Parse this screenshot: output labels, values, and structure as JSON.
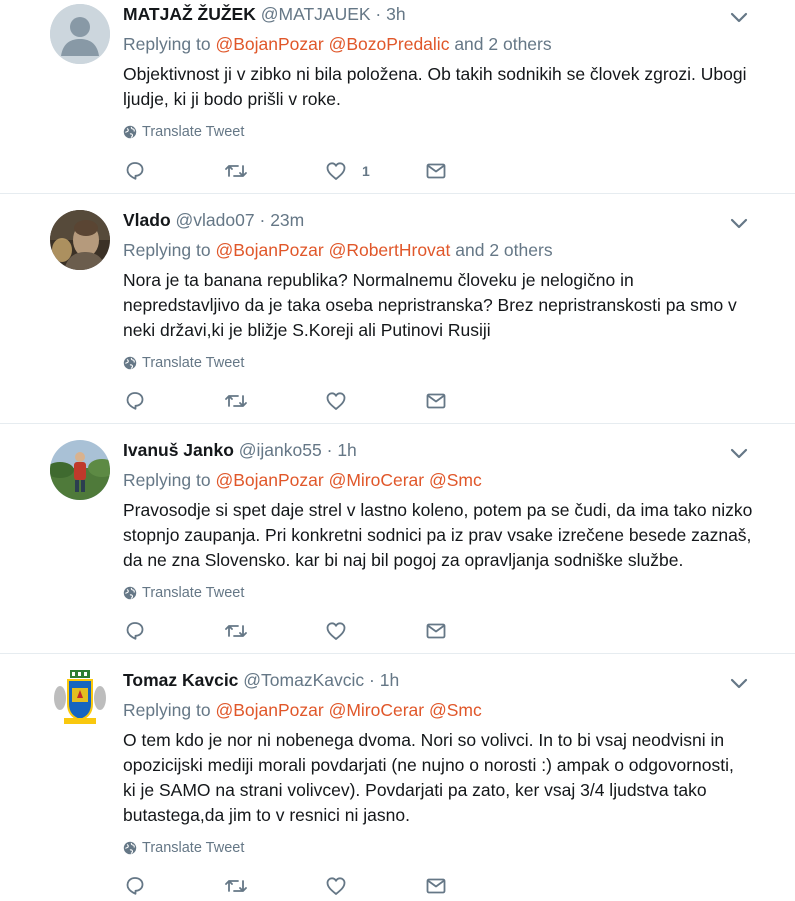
{
  "icons": {
    "caret": "chevron-down-icon",
    "globe": "globe-icon",
    "reply": "reply-icon",
    "retweet": "retweet-icon",
    "like": "heart-icon",
    "message": "envelope-icon"
  },
  "colors": {
    "mention": "#e0572a",
    "muted": "#657786",
    "text": "#14171a",
    "border": "#e6ecf0"
  },
  "tweets": [
    {
      "name": "MATJAŽ ŽUŽEK",
      "handle": "@MATJAUEK",
      "dot": "·",
      "time": "3h",
      "replying_prefix": "Replying to",
      "mentions": [
        "@BojanPozar",
        "@BozoPredalic"
      ],
      "replying_suffix": "and 2 others",
      "lines": [
        "Objektivnost ji v zibko ni bila položena. Ob takih sodnikih se človek zgrozi. Ubogi",
        "ljudje, ki ji bodo prišli v roke."
      ],
      "translate": "Translate Tweet",
      "like_count": "1"
    },
    {
      "name": "Vlado",
      "handle": "@vlado07",
      "dot": "·",
      "time": "23m",
      "replying_prefix": "Replying to",
      "mentions": [
        "@BojanPozar",
        "@RobertHrovat"
      ],
      "replying_suffix": "and 2 others",
      "lines": [
        "Nora je ta banana republika?  Normalnemu človeku je nelogično in",
        "nepredstavljivo da je taka oseba nepristranska? Brez nepristranskosti pa smo v",
        "neki državi,ki je bližje S.Koreji ali Putinovi Rusiji"
      ],
      "translate": "Translate Tweet",
      "like_count": ""
    },
    {
      "name": "Ivanuš Janko",
      "handle": "@ijanko55",
      "dot": "·",
      "time": "1h",
      "replying_prefix": "Replying to",
      "mentions": [
        "@BojanPozar",
        "@MiroCerar",
        "@Smc"
      ],
      "replying_suffix": "",
      "lines": [
        "Pravosodje si spet daje strel v lastno koleno, potem pa se čudi, da ima tako nizko",
        "stopnjo zaupanja. Pri konkretni sodnici pa iz prav vsake izrečene besede zaznaš,",
        "da ne zna Slovensko. kar bi naj bil pogoj za opravljanja sodniške službe."
      ],
      "translate": "Translate Tweet",
      "like_count": ""
    },
    {
      "name": "Tomaz Kavcic",
      "handle": "@TomazKavcic",
      "dot": "·",
      "time": "1h",
      "replying_prefix": "Replying to",
      "mentions": [
        "@BojanPozar",
        "@MiroCerar",
        "@Smc"
      ],
      "replying_suffix": "",
      "lines": [
        "O tem kdo je nor ni nobenega dvoma. Nori so volivci. In to bi vsaj neodvisni in",
        "opozicijski mediji morali povdarjati (ne nujno o norosti :) ampak o odgovornosti,",
        "ki je SAMO na strani volivcev). Povdarjati pa zato, ker vsaj 3/4 ljudstva tako",
        "butastega,da jim to v resnici ni jasno."
      ],
      "translate": "Translate Tweet",
      "like_count": ""
    }
  ]
}
